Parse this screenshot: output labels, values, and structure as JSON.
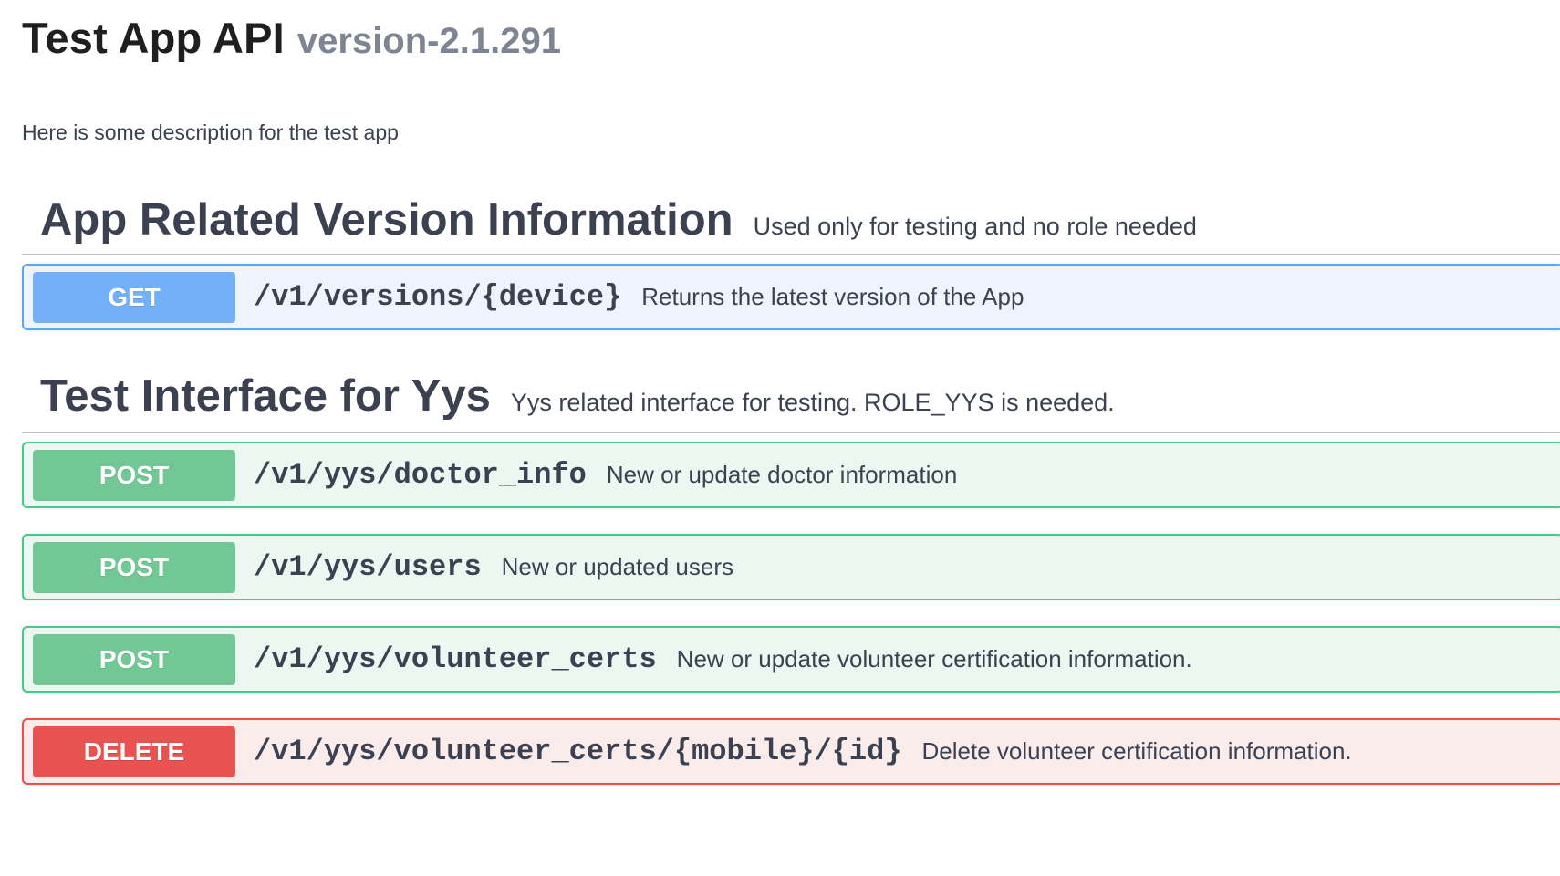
{
  "info": {
    "title": "Test App API",
    "version": "version-2.1.291",
    "description": "Here is some description for the test app"
  },
  "tags": [
    {
      "name": "App Related Version Information",
      "description": "Used only for testing and no role needed",
      "operations": [
        {
          "method": "GET",
          "path": "/v1/versions/{device}",
          "summary": "Returns the latest version of the App"
        }
      ]
    },
    {
      "name": "Test Interface for Yys",
      "description": "Yys related interface for testing. ROLE_YYS is needed.",
      "operations": [
        {
          "method": "POST",
          "path": "/v1/yys/doctor_info",
          "summary": "New or update doctor information"
        },
        {
          "method": "POST",
          "path": "/v1/yys/users",
          "summary": "New or updated users"
        },
        {
          "method": "POST",
          "path": "/v1/yys/volunteer_certs",
          "summary": "New or update volunteer certification information."
        },
        {
          "method": "DELETE",
          "path": "/v1/yys/volunteer_certs/{mobile}/{id}",
          "summary": "Delete volunteer certification information."
        }
      ]
    }
  ],
  "colors": {
    "get": "#74b0f7",
    "post": "#72c894",
    "delete": "#e85250"
  }
}
